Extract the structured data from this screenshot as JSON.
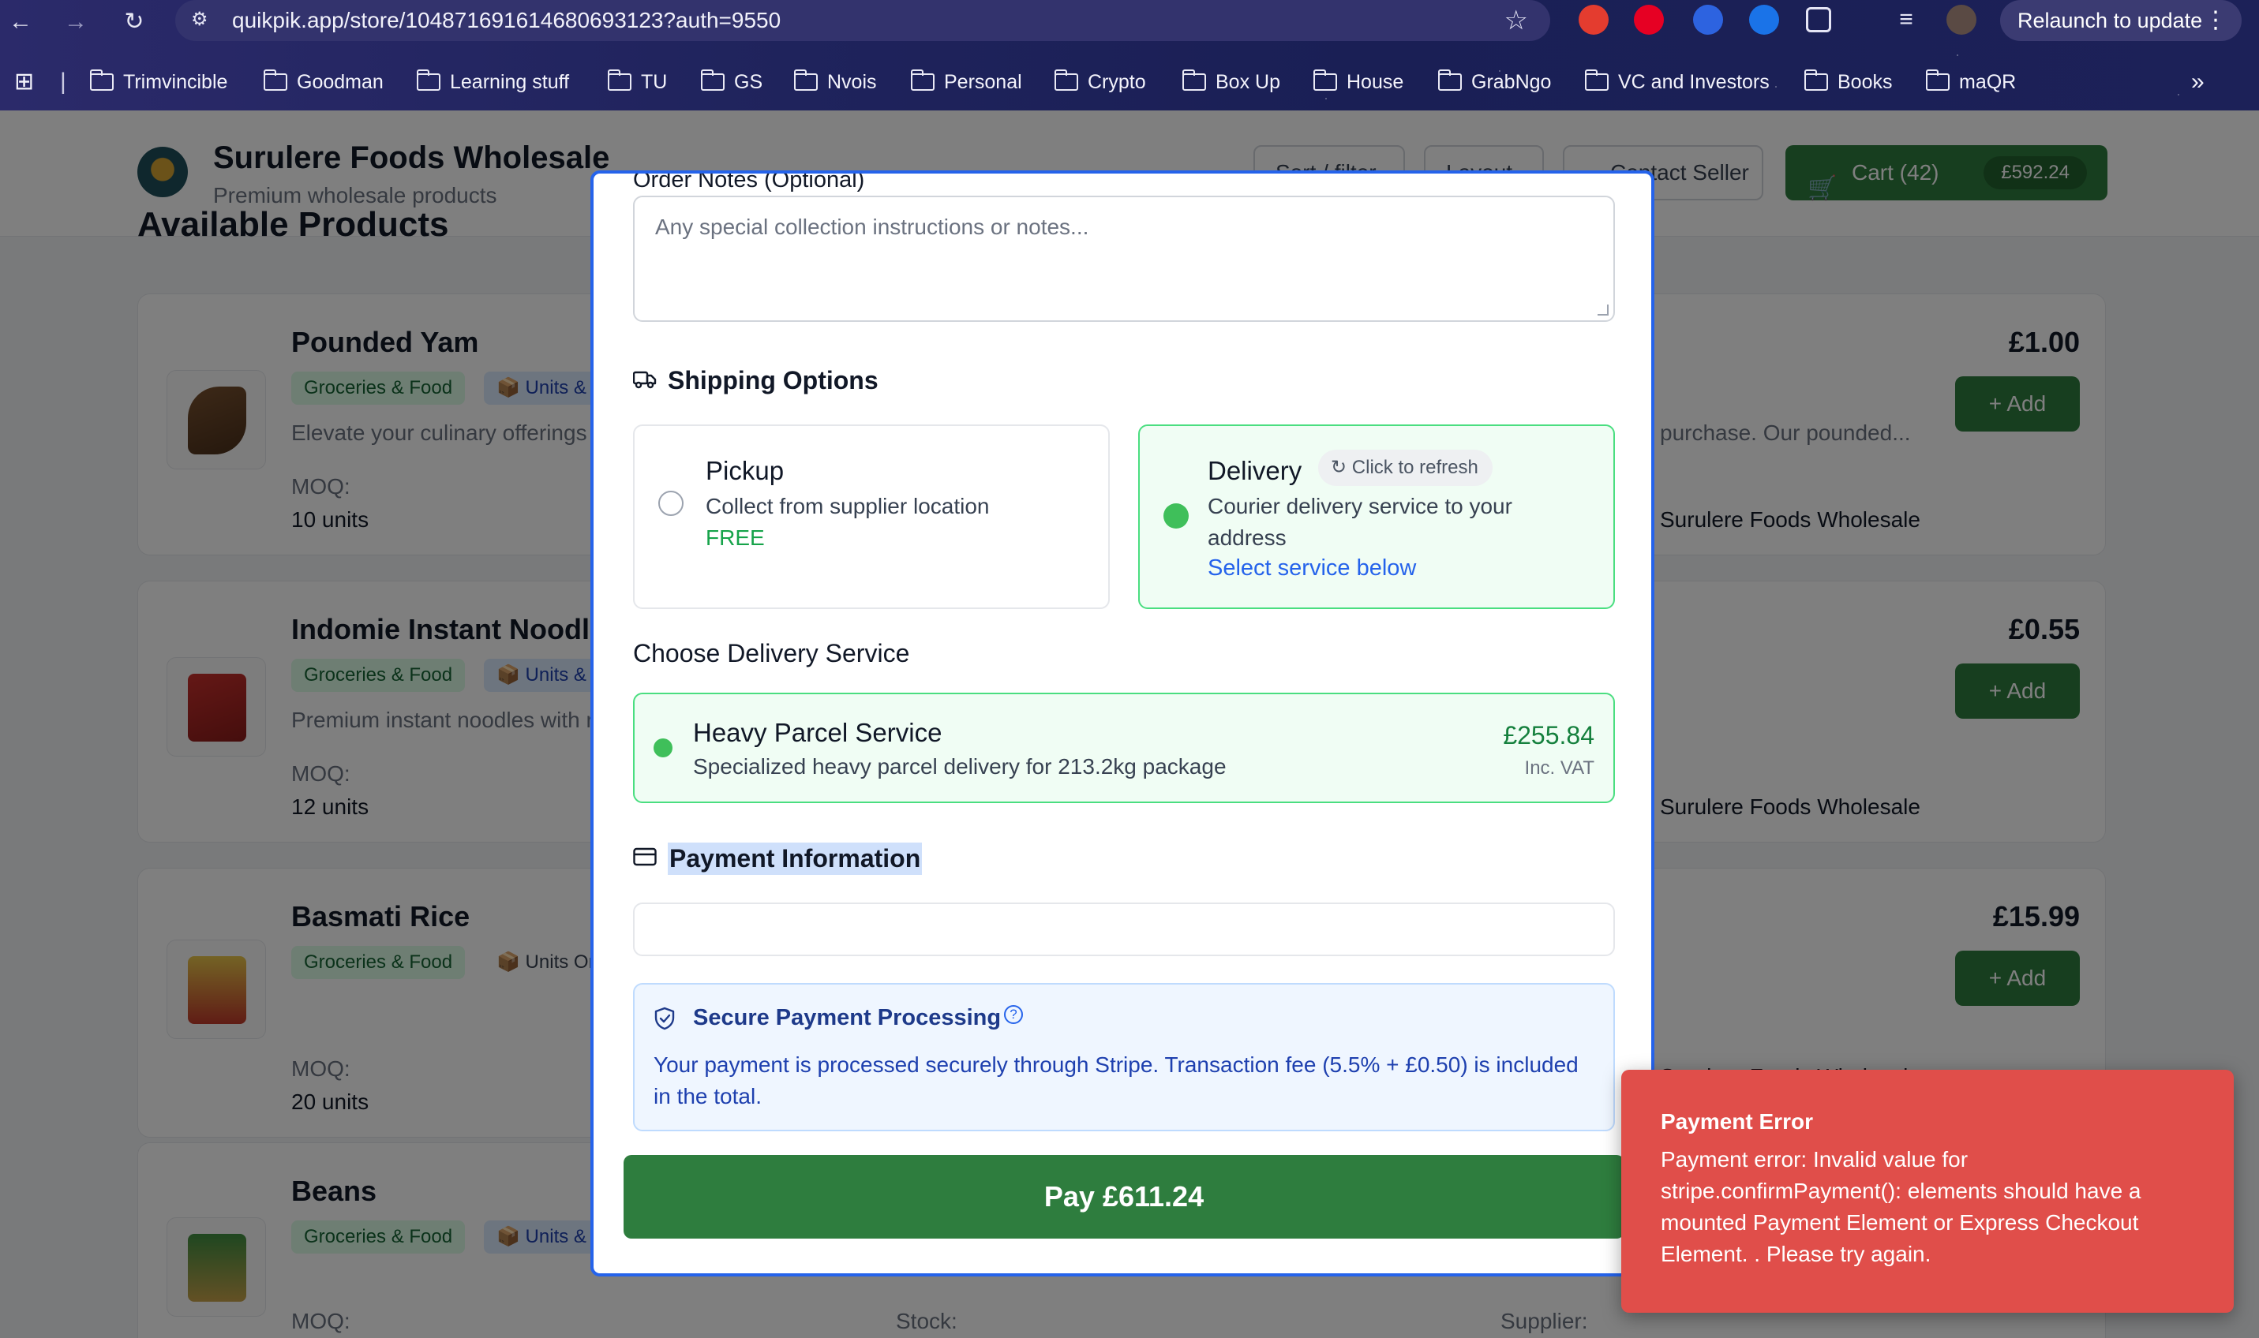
{
  "browser": {
    "url": "quikpik.app/store/104871691614680693123?auth=9550",
    "relaunch_label": "Relaunch to update",
    "bookmarks": [
      "Trimvincible",
      "Goodman",
      "Learning stuff",
      "TU",
      "GS",
      "Nvois",
      "Personal",
      "Crypto",
      "Box Up",
      "House",
      "GrabNgo",
      "VC and Investors",
      "Books",
      "maQR"
    ]
  },
  "store": {
    "name": "Surulere Foods Wholesale",
    "subtitle": "Premium wholesale products",
    "header_buttons": [
      "Sort / filter",
      "Layout",
      "Contact Seller"
    ],
    "cart_label": "Cart (42)",
    "cart_total": "£592.24",
    "section_title": "Available Products",
    "products": [
      {
        "name": "Pounded Yam",
        "category": "Groceries & Food",
        "unit": "📦 Units & Boxes",
        "description": "Elevate your culinary offerings with premium pounded yam flour…",
        "description_right": "purchase. Our pounded...",
        "moq_label": "MOQ:",
        "moq": "10 units",
        "price": "£1.00",
        "supplier": "Surulere Foods Wholesale",
        "add_label": "+ Add"
      },
      {
        "name": "Indomie Instant Noodles",
        "category": "Groceries & Food",
        "unit": "📦 Units & Boxes",
        "description": "Premium instant noodles with rich flavour…",
        "description_right": "",
        "moq_label": "MOQ:",
        "moq": "12 units",
        "price": "£0.55",
        "supplier": "Surulere Foods Wholesale",
        "add_label": "+ Add"
      },
      {
        "name": "Basmati Rice",
        "category": "Groceries & Food",
        "unit": "📦 Units Only",
        "description": "",
        "description_right": "",
        "moq_label": "MOQ:",
        "moq": "20 units",
        "price": "£15.99",
        "supplier": "Surulere Foods Wholesale",
        "add_label": "+ Add"
      },
      {
        "name": "Beans",
        "category": "Groceries & Food",
        "unit": "📦 Units & Boxes",
        "description": "",
        "description_right": "",
        "moq_label": "MOQ:",
        "moq": "",
        "price": "",
        "supplier": "Supplier:",
        "add_label": ""
      }
    ],
    "stock_label": "Stock:"
  },
  "modal": {
    "notes_label": "Order Notes (Optional)",
    "notes_placeholder": "Any special collection instructions or notes...",
    "shipping_heading": "Shipping Options",
    "pickup": {
      "title": "Pickup",
      "desc": "Collect from supplier location",
      "price": "FREE"
    },
    "delivery": {
      "title": "Delivery",
      "refresh": "Click to refresh",
      "desc_line1": "Courier delivery service to your",
      "desc_line2": "address",
      "link": "Select service below"
    },
    "choose_service_heading": "Choose Delivery Service",
    "service": {
      "name": "Heavy Parcel Service",
      "desc": "Specialized heavy parcel delivery for 213.2kg package",
      "price": "£255.84",
      "vat": "Inc. VAT"
    },
    "payment_heading": "Payment Information",
    "secure": {
      "title": "Secure Payment Processing",
      "text": "Your payment is processed securely through Stripe. Transaction fee (5.5% + £0.50) is included in the total."
    },
    "pay_button": "Pay £611.24"
  },
  "toast": {
    "title": "Payment Error",
    "message": "Payment error: Invalid value for stripe.confirmPayment(): elements should have a mounted Payment Element or Express Checkout Element. . Please try again."
  }
}
